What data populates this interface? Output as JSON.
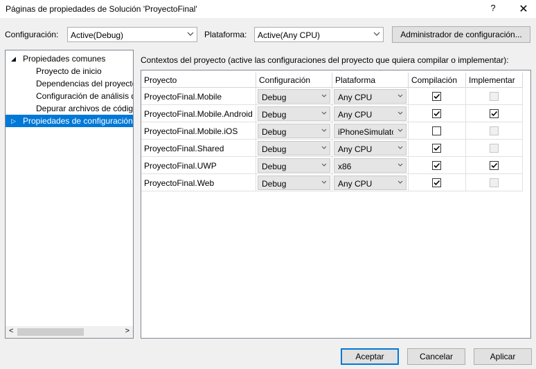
{
  "window": {
    "title": "Páginas de propiedades de Solución 'ProyectoFinal'",
    "help_label": "?",
    "close_label": "✕"
  },
  "toolbar": {
    "config_label": "Configuración:",
    "config_value": "Active(Debug)",
    "platform_label": "Plataforma:",
    "platform_value": "Active(Any CPU)",
    "manager_button": "Administrador de configuración..."
  },
  "tree": {
    "items": [
      {
        "label": "Propiedades comunes",
        "expander": "◢"
      },
      {
        "label": "Proyecto de inicio"
      },
      {
        "label": "Dependencias del proyecto"
      },
      {
        "label": "Configuración de análisis de código"
      },
      {
        "label": "Depurar archivos de código fuente"
      },
      {
        "label": "Propiedades de configuración",
        "expander": "▷"
      }
    ]
  },
  "contexts": {
    "label": "Contextos del proyecto (active las configuraciones del proyecto que quiera compilar o implementar):",
    "columns": [
      "Proyecto",
      "Configuración",
      "Plataforma",
      "Compilación",
      "Implementar"
    ],
    "rows": [
      {
        "project": "ProyectoFinal.Mobile",
        "configuration": "Debug",
        "platform": "Any CPU",
        "build": true,
        "deploy": false,
        "deploy_enabled": false
      },
      {
        "project": "ProyectoFinal.Mobile.Android",
        "configuration": "Debug",
        "platform": "Any CPU",
        "build": true,
        "deploy": true,
        "deploy_enabled": true
      },
      {
        "project": "ProyectoFinal.Mobile.iOS",
        "configuration": "Debug",
        "platform": "iPhoneSimulator",
        "build": false,
        "deploy": false,
        "deploy_enabled": false
      },
      {
        "project": "ProyectoFinal.Shared",
        "configuration": "Debug",
        "platform": "Any CPU",
        "build": true,
        "deploy": false,
        "deploy_enabled": false
      },
      {
        "project": "ProyectoFinal.UWP",
        "configuration": "Debug",
        "platform": "x86",
        "build": true,
        "deploy": true,
        "deploy_enabled": true
      },
      {
        "project": "ProyectoFinal.Web",
        "configuration": "Debug",
        "platform": "Any CPU",
        "build": true,
        "deploy": false,
        "deploy_enabled": false
      }
    ]
  },
  "footer": {
    "accept": "Aceptar",
    "cancel": "Cancelar",
    "apply": "Aplicar"
  },
  "colors": {
    "selection": "#0078d7",
    "dialog_bg": "#f0f0f0"
  }
}
